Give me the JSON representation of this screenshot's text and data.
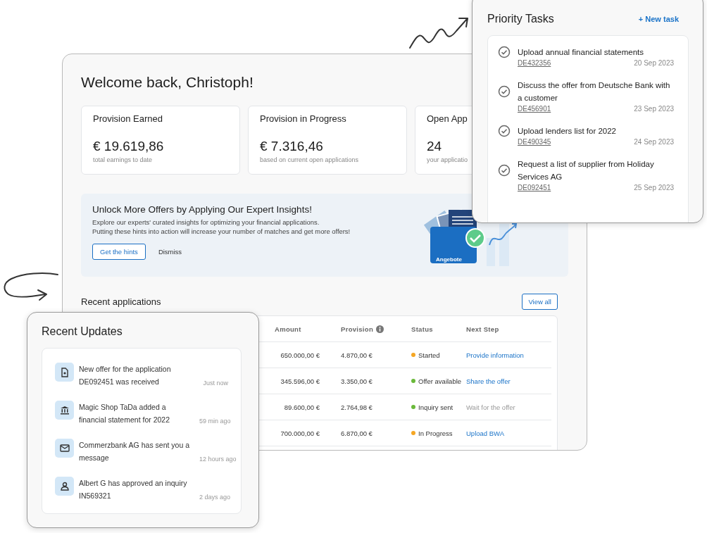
{
  "dashboard": {
    "greeting": "Welcome back, Christoph!",
    "stats": [
      {
        "label": "Provision Earned",
        "value": "€ 19.619,86",
        "caption": "total earnings to date"
      },
      {
        "label": "Provision in Progress",
        "value": "€ 7.316,46",
        "caption": "based on current open applications"
      },
      {
        "label": "Open App",
        "value": "24",
        "caption": "your applicatio"
      }
    ],
    "banner": {
      "title": "Unlock More Offers by Applying Our Expert Insights!",
      "lines": [
        "Explore our experts' curated insights for optimizing your financial applications.",
        "Putting these hints into action will increase your number of matches and get more offers!"
      ],
      "primary_button": "Get the hints",
      "secondary_button": "Dismiss",
      "illustration_label": "Angebote"
    },
    "recent_applications": {
      "title": "Recent applications",
      "view_all": "View all",
      "columns": [
        "Amount",
        "Provision",
        "Status",
        "Next Step"
      ],
      "rows": [
        {
          "amount": "650.000,00 €",
          "provision": "4.870,00 €",
          "status": {
            "label": "Started",
            "color": "#f5a623"
          },
          "next_step": {
            "label": "Provide information",
            "kind": "link"
          }
        },
        {
          "amount": "345.596,00 €",
          "provision": "3.350,00 €",
          "status": {
            "label": "Offer available",
            "color": "#6ab93a"
          },
          "next_step": {
            "label": "Share the offer",
            "kind": "link"
          }
        },
        {
          "amount": "89.600,00 €",
          "provision": "2.764,98 €",
          "status": {
            "label": "Inquiry sent",
            "color": "#6ab93a"
          },
          "next_step": {
            "label": "Wait for the offer",
            "kind": "text"
          }
        },
        {
          "amount": "700.000,00 €",
          "provision": "6.870,00 €",
          "status": {
            "label": "In Progress",
            "color": "#f5a623"
          },
          "next_step": {
            "label": "Upload BWA",
            "kind": "link"
          }
        }
      ]
    }
  },
  "priority_tasks": {
    "title": "Priority Tasks",
    "new_task": "+ New task",
    "tasks": [
      {
        "title": "Upload annual financial statements",
        "id": "DE432356",
        "date": "20 Sep 2023"
      },
      {
        "title": "Discuss the offer from Deutsche Bank with a customer",
        "id": "DE456901",
        "date": "23 Sep 2023"
      },
      {
        "title": "Upload lenders list for 2022",
        "id": "DE490345",
        "date": "24 Sep 2023"
      },
      {
        "title": "Request a list of supplier from Holiday Services AG",
        "id": "DE092451",
        "date": "25 Sep 2023"
      }
    ]
  },
  "recent_updates": {
    "title": "Recent Updates",
    "items": [
      {
        "kind": "document",
        "text": "New offer for the application DE092451 was received",
        "time": "Just now"
      },
      {
        "kind": "bank",
        "text": "Magic Shop TaDa added a financial statement for 2022",
        "time": "59 min ago"
      },
      {
        "kind": "mail",
        "text": "Commerzbank AG has sent you a message",
        "time": "12 hours ago"
      },
      {
        "kind": "person",
        "text": "Albert G has approved an inquiry IN569321",
        "time": "2 days ago"
      }
    ]
  }
}
